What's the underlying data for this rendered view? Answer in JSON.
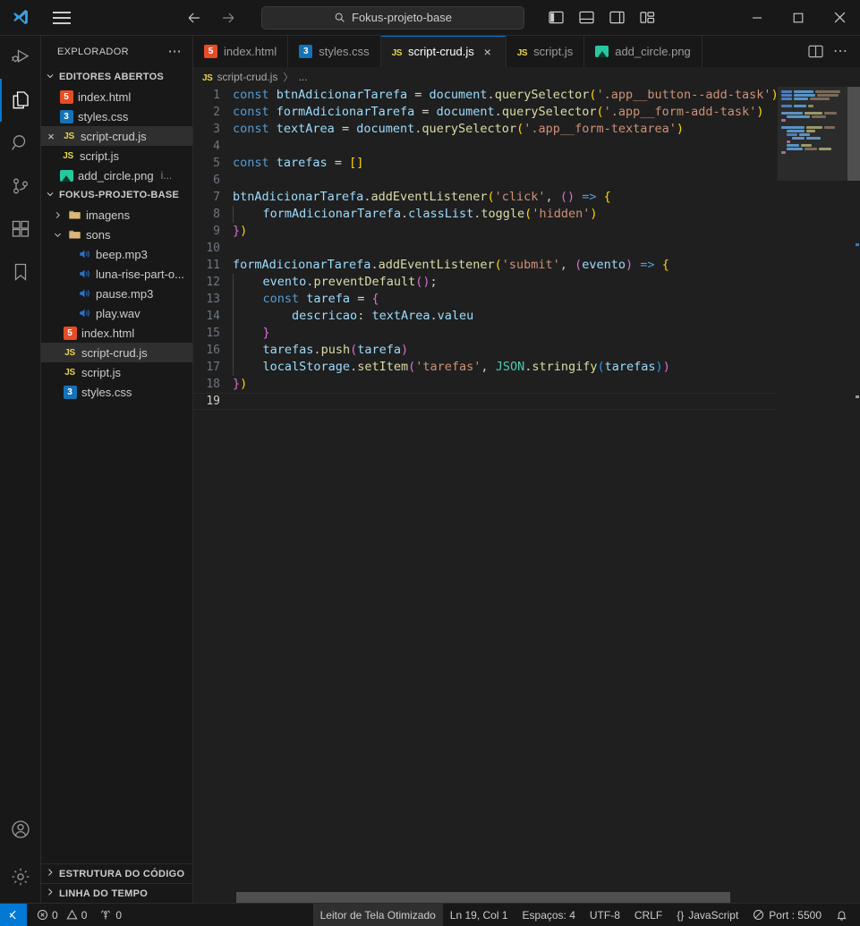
{
  "titlebar": {
    "search_text": "Fokus-projeto-base",
    "logo_name": "vscode-logo",
    "menu_label": "menu",
    "back_label": "back",
    "forward_label": "forward",
    "layout_icons": [
      "toggle-primary-sidebar",
      "toggle-panel",
      "toggle-secondary-sidebar",
      "customize-layout"
    ],
    "window_buttons": [
      "minimize",
      "maximize",
      "close"
    ]
  },
  "activitybar": {
    "items": [
      {
        "name": "run-and-debug",
        "label": "Executar e Depurar"
      },
      {
        "name": "explorer",
        "label": "Explorador",
        "active": true
      },
      {
        "name": "search",
        "label": "Pesquisar"
      },
      {
        "name": "source-control",
        "label": "Controle do Código-Fonte"
      },
      {
        "name": "extensions",
        "label": "Extensões"
      },
      {
        "name": "bookmarks",
        "label": "Marcadores"
      }
    ],
    "bottom_items": [
      {
        "name": "accounts",
        "label": "Contas"
      },
      {
        "name": "settings",
        "label": "Gerenciar"
      }
    ]
  },
  "sidebar": {
    "title": "EXPLORADOR",
    "more_actions": "⋯",
    "open_editors": {
      "label": "EDITORES ABERTOS",
      "expanded": true,
      "items": [
        {
          "label": "index.html",
          "icon": "html-file-icon",
          "selected": false,
          "dirty": false
        },
        {
          "label": "styles.css",
          "icon": "css-file-icon",
          "selected": false,
          "dirty": false
        },
        {
          "label": "script-crud.js",
          "icon": "js-file-icon",
          "selected": true,
          "close": "×"
        },
        {
          "label": "script.js",
          "icon": "js-file-icon",
          "selected": false
        },
        {
          "label": "add_circle.png",
          "icon": "png-file-icon",
          "selected": false,
          "suffix": "i..."
        }
      ]
    },
    "workspace": {
      "label": "FOKUS-PROJETO-BASE",
      "expanded": true,
      "items": [
        {
          "label": "imagens",
          "icon": "folder-icon",
          "type": "folder",
          "expanded": false,
          "indent": 1
        },
        {
          "label": "sons",
          "icon": "folder-open-icon",
          "type": "folder",
          "expanded": true,
          "indent": 1
        },
        {
          "label": "beep.mp3",
          "icon": "audio-file-icon",
          "type": "file",
          "indent": 2
        },
        {
          "label": "luna-rise-part-o...",
          "icon": "audio-file-icon",
          "type": "file",
          "indent": 2
        },
        {
          "label": "pause.mp3",
          "icon": "audio-file-icon",
          "type": "file",
          "indent": 2
        },
        {
          "label": "play.wav",
          "icon": "audio-file-icon",
          "type": "file",
          "indent": 2
        },
        {
          "label": "index.html",
          "icon": "html-file-icon",
          "type": "file",
          "indent": 1
        },
        {
          "label": "script-crud.js",
          "icon": "js-file-icon",
          "type": "file",
          "indent": 1,
          "selected": true
        },
        {
          "label": "script.js",
          "icon": "js-file-icon",
          "type": "file",
          "indent": 1
        },
        {
          "label": "styles.css",
          "icon": "css-file-icon",
          "type": "file",
          "indent": 1
        }
      ]
    },
    "bottom_panels": [
      {
        "label": "ESTRUTURA DO CÓDIGO",
        "expanded": false
      },
      {
        "label": "LINHA DO TEMPO",
        "expanded": false
      }
    ]
  },
  "tabs": [
    {
      "label": "index.html",
      "icon": "html-file-icon",
      "active": false
    },
    {
      "label": "styles.css",
      "icon": "css-file-icon",
      "active": false
    },
    {
      "label": "script-crud.js",
      "icon": "js-file-icon",
      "active": true,
      "close": "×"
    },
    {
      "label": "script.js",
      "icon": "js-file-icon",
      "active": false
    },
    {
      "label": "add_circle.png",
      "icon": "png-file-icon",
      "active": false
    }
  ],
  "tab_actions": [
    "split-editor",
    "more-actions"
  ],
  "breadcrumbs": {
    "file": "script-crud.js",
    "icon": "js-file-icon",
    "separator": "〉",
    "rest": "..."
  },
  "editor": {
    "language": "JavaScript",
    "total_lines": 19,
    "lines": [
      {
        "n": 1,
        "text": "const btnAdicionarTarefa = document.querySelector('.app__button--add-task')"
      },
      {
        "n": 2,
        "text": "const formAdicionarTarefa = document.querySelector('.app__form-add-task')"
      },
      {
        "n": 3,
        "text": "const textArea = document.querySelector('.app__form-textarea')"
      },
      {
        "n": 4,
        "text": ""
      },
      {
        "n": 5,
        "text": "const tarefas = []"
      },
      {
        "n": 6,
        "text": ""
      },
      {
        "n": 7,
        "text": "btnAdicionarTarefa.addEventListener('click', () => {"
      },
      {
        "n": 8,
        "text": "    formAdicionarTarefa.classList.toggle('hidden')"
      },
      {
        "n": 9,
        "text": "})"
      },
      {
        "n": 10,
        "text": ""
      },
      {
        "n": 11,
        "text": "formAdicionarTarefa.addEventListener('submit', (evento) => {"
      },
      {
        "n": 12,
        "text": "    evento.preventDefault();"
      },
      {
        "n": 13,
        "text": "    const tarefa = {"
      },
      {
        "n": 14,
        "text": "        descricao: textArea.valeu"
      },
      {
        "n": 15,
        "text": "    }"
      },
      {
        "n": 16,
        "text": "    tarefas.push(tarefa)"
      },
      {
        "n": 17,
        "text": "    localStorage.setItem('tarefas', JSON.stringify(tarefas))"
      },
      {
        "n": 18,
        "text": "})"
      },
      {
        "n": 19,
        "text": ""
      }
    ]
  },
  "statusbar": {
    "remote_icon": "remote-window-icon",
    "errors_icon": "error-icon",
    "errors": "0",
    "warnings_icon": "warning-icon",
    "warnings": "0",
    "ports_icon": "radio-tower-icon",
    "ports": "0",
    "screen_reader": "Leitor de Tela Otimizado",
    "cursor_position": "Ln 19, Col 1",
    "indentation": "Espaços: 4",
    "encoding": "UTF-8",
    "eol": "CRLF",
    "language_icon": "{}",
    "language": "JavaScript",
    "live_server_icon": "circle-slash-icon",
    "live_server": "Port : 5500",
    "bell_icon": "bell-icon"
  },
  "colors": {
    "accent": "#0078d4",
    "editor_bg": "#1f1f1f",
    "chrome_bg": "#181818",
    "selected_row": "#2f2f2f",
    "text": "#cccccc"
  }
}
